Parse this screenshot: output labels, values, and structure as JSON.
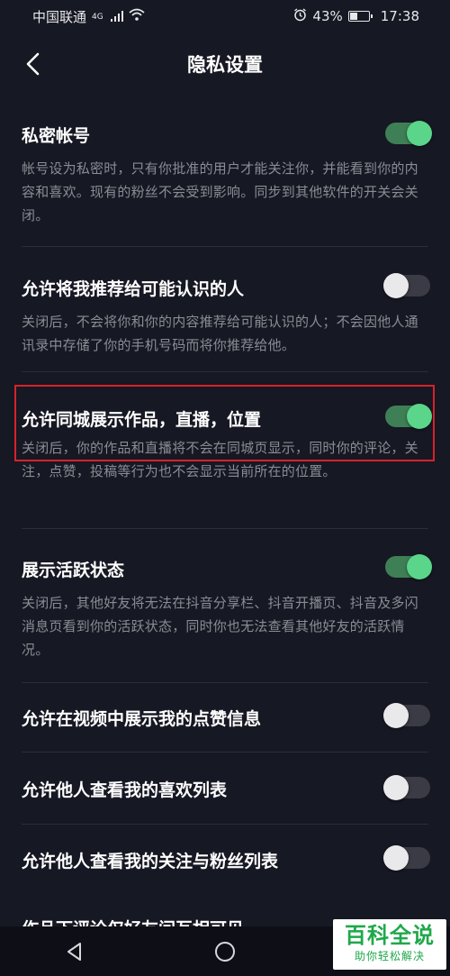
{
  "status_bar": {
    "carrier": "中国联通",
    "network": "4G",
    "battery_percent": "43%",
    "battery_level": 0.43,
    "time": "17:38",
    "alarm_icon": "alarm-icon",
    "wifi_icon": "wifi-icon"
  },
  "header": {
    "title": "隐私设置",
    "back_icon": "chevron-left-icon"
  },
  "settings": [
    {
      "label": "私密帐号",
      "description": "帐号设为私密时，只有你批准的用户才能关注你，并能看到你的内容和喜欢。现有的粉丝不会受到影响。同步到其他软件的开关会关闭。",
      "enabled": true
    },
    {
      "label": "允许将我推荐给可能认识的人",
      "description": "关闭后，不会将你和你的内容推荐给可能认识的人；不会因他人通讯录中存储了你的手机号码而将你推荐给他。",
      "enabled": false
    },
    {
      "label": "允许同城展示作品，直播，位置",
      "description": "关闭后，你的作品和直播将不会在同城页显示，同时你的评论，关注，点赞，投稿等行为也不会显示当前所在的位置。",
      "enabled": true
    },
    {
      "label": "展示活跃状态",
      "description": "关闭后，其他好友将无法在抖音分享栏、抖音开播页、抖音及多闪消息页看到你的活跃状态，同时你也无法查看其他好友的活跃情况。",
      "enabled": true
    },
    {
      "label": "允许在视频中展示我的点赞信息",
      "enabled": false
    },
    {
      "label": "允许他人查看我的喜欢列表",
      "enabled": false
    },
    {
      "label": "允许他人查看我的关注与粉丝列表",
      "enabled": false
    },
    {
      "label": "作品下评论仅好友间互相可见"
    }
  ],
  "colors": {
    "background": "#161823",
    "toggle_on": "#5ad58a",
    "toggle_off": "#3a3b44",
    "highlight": "#d8222a",
    "description": "#8b8c93"
  },
  "nav": {
    "back_icon": "triangle-back-icon",
    "home_icon": "circle-home-icon",
    "recents_icon": "square-recents-icon"
  },
  "watermark": {
    "main": "百科全说",
    "sub": "助你轻松解决"
  }
}
